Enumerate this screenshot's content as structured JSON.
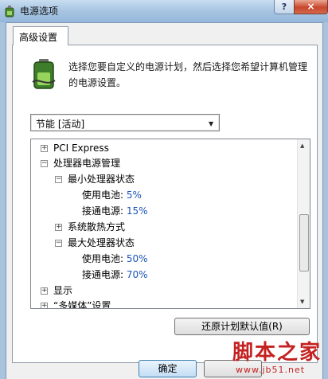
{
  "window": {
    "title": "电源选项",
    "help_label": "?",
    "close_label": "×"
  },
  "tab": {
    "label": "高级设置"
  },
  "description": "选择您要自定义的电源计划，然后选择您希望计算机管理的电源设置。",
  "plan_select": {
    "value": "节能 [活动]"
  },
  "tree": {
    "pci": {
      "expander": "+",
      "label": "PCI Express"
    },
    "cpu": {
      "expander": "−",
      "label": "处理器电源管理"
    },
    "min_state": {
      "expander": "−",
      "label": "最小处理器状态"
    },
    "min_battery": {
      "label": "使用电池:",
      "value": "5%"
    },
    "min_plugged": {
      "label": "接通电源:",
      "value": "15%"
    },
    "cooling": {
      "expander": "+",
      "label": "系统散热方式"
    },
    "max_state": {
      "expander": "−",
      "label": "最大处理器状态"
    },
    "max_battery": {
      "label": "使用电池:",
      "value": "50%"
    },
    "max_plugged": {
      "label": "接通电源:",
      "value": "70%"
    },
    "display": {
      "expander": "+",
      "label": "显示"
    },
    "multimedia": {
      "expander": "+",
      "label": "“多媒体”设置"
    }
  },
  "buttons": {
    "restore": "还原计划默认值(R)",
    "ok": "确定"
  },
  "watermark": {
    "text": "脚本之家",
    "url": "www.jb51.net"
  },
  "colors": {
    "accent": "#1a56b8",
    "watermark": "#c42121"
  }
}
